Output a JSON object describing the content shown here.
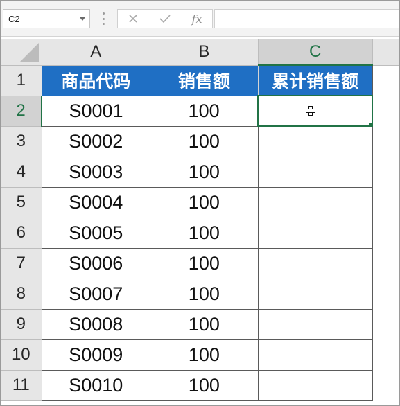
{
  "name_box": {
    "value": "C2"
  },
  "formula_bar": {
    "cancel_icon": "close-icon",
    "enter_icon": "check-icon",
    "function_label": "fx",
    "value": ""
  },
  "columns": [
    "A",
    "B",
    "C"
  ],
  "selected_cell": {
    "column": "C",
    "row": "2"
  },
  "header_row": {
    "row_number": "1",
    "cells": [
      "商品代码",
      "销售额",
      "累计销售额"
    ]
  },
  "rows": [
    {
      "row_number": "2",
      "code": "S0001",
      "sales": "100",
      "cumulative": ""
    },
    {
      "row_number": "3",
      "code": "S0002",
      "sales": "100",
      "cumulative": ""
    },
    {
      "row_number": "4",
      "code": "S0003",
      "sales": "100",
      "cumulative": ""
    },
    {
      "row_number": "5",
      "code": "S0004",
      "sales": "100",
      "cumulative": ""
    },
    {
      "row_number": "6",
      "code": "S0005",
      "sales": "100",
      "cumulative": ""
    },
    {
      "row_number": "7",
      "code": "S0006",
      "sales": "100",
      "cumulative": ""
    },
    {
      "row_number": "8",
      "code": "S0007",
      "sales": "100",
      "cumulative": ""
    },
    {
      "row_number": "9",
      "code": "S0008",
      "sales": "100",
      "cumulative": ""
    },
    {
      "row_number": "10",
      "code": "S0009",
      "sales": "100",
      "cumulative": ""
    },
    {
      "row_number": "11",
      "code": "S0010",
      "sales": "100",
      "cumulative": ""
    }
  ],
  "colors": {
    "header_fill": "#1f6fc4",
    "header_text": "#ffffff",
    "selection": "#217346"
  }
}
